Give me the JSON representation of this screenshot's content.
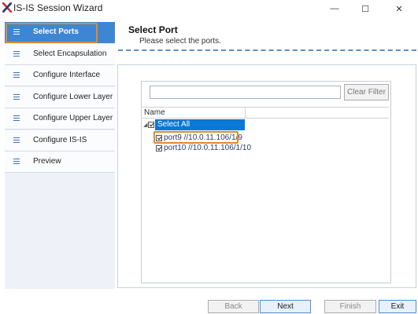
{
  "window": {
    "title": "IS-IS Session Wizard",
    "minimize_glyph": "—",
    "maximize_glyph": "☐",
    "close_glyph": "✕",
    "logo_icon": "ixia-x-logo",
    "logo_color": "#d0302d"
  },
  "sidebar": {
    "items": [
      {
        "label": "Select Ports",
        "active": true
      },
      {
        "label": "Select Encapsulation",
        "active": false
      },
      {
        "label": "Configure Interface",
        "active": false
      },
      {
        "label": "Configure Lower Layer",
        "active": false
      },
      {
        "label": "Configure Upper Layer",
        "active": false
      },
      {
        "label": "Configure IS-IS",
        "active": false
      },
      {
        "label": "Preview",
        "active": false
      }
    ],
    "item_icon": "list-icon",
    "active_color": "#3d86d4"
  },
  "page": {
    "title": "Select Port",
    "subtitle": "Please select the ports."
  },
  "filter": {
    "value": "",
    "clear_label": "Clear Filter"
  },
  "tree": {
    "column_name": "Name",
    "select_all": {
      "label": "Select All",
      "checked": true
    },
    "ports": [
      {
        "label": "port9 //10.0.11.106/1/9",
        "checked": true
      },
      {
        "label": "port10 //10.0.11.106/1/10",
        "checked": true
      }
    ]
  },
  "footer": {
    "back_label": "Back",
    "next_label": "Next",
    "finish_label": "Finish",
    "exit_label": "Exit"
  },
  "annotation_color": "#e08a2c"
}
